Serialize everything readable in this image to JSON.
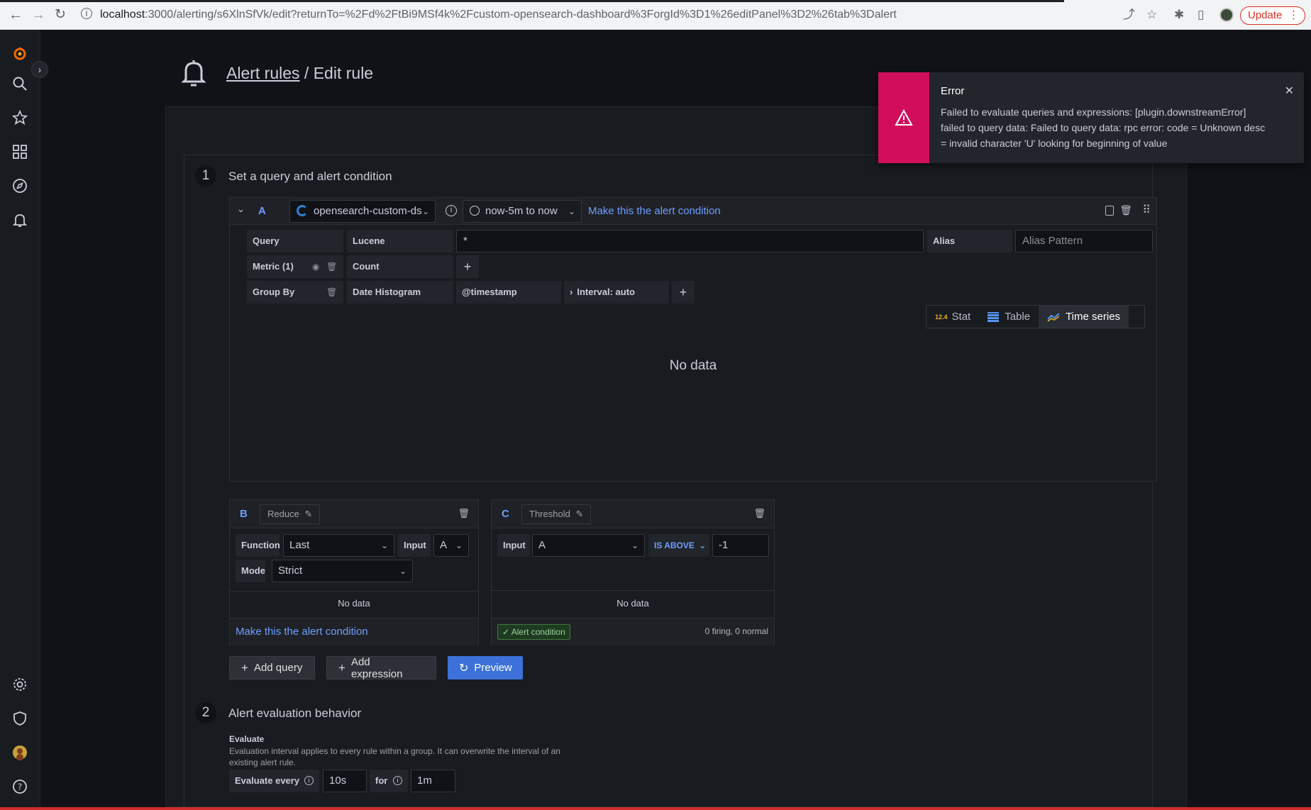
{
  "browser": {
    "url_host": "localhost",
    "url_rest": ":3000/alerting/s6XlnSfVk/edit?returnTo=%2Fd%2FtBi9MSf4k%2Fcustom-opensearch-dashboard%3ForgId%3D1%26editPanel%3D2%26tab%3Dalert",
    "update_label": "Update"
  },
  "header": {
    "link": "Alert rules",
    "separator": " / ",
    "title": "Edit rule"
  },
  "step1": {
    "number": "1",
    "title": "Set a query and alert condition"
  },
  "queryA": {
    "letter": "A",
    "datasource": "opensearch-custom-ds",
    "timerange": "now-5m to now",
    "make_condition": "Make this the alert condition",
    "query_label": "Query",
    "query_type": "Lucene",
    "query_value": "*",
    "alias_label": "Alias",
    "alias_placeholder": "Alias Pattern",
    "metric_label": "Metric (1)",
    "metric_value": "Count",
    "groupby_label": "Group By",
    "groupby_value": "Date Histogram",
    "groupby_field": "@timestamp",
    "interval": "Interval: auto",
    "viz": {
      "stat": "Stat",
      "table": "Table",
      "timeseries": "Time series",
      "stat_badge": "12.4"
    },
    "no_data": "No data"
  },
  "exprB": {
    "letter": "B",
    "type": "Reduce",
    "function_label": "Function",
    "function_value": "Last",
    "input_label": "Input",
    "input_value": "A",
    "mode_label": "Mode",
    "mode_value": "Strict",
    "no_data": "No data",
    "make_condition": "Make this the alert condition"
  },
  "exprC": {
    "letter": "C",
    "type": "Threshold",
    "input_label": "Input",
    "input_value": "A",
    "op": "IS ABOVE",
    "value": "-1",
    "no_data": "No data",
    "condition_badge": "Alert condition",
    "status": "0 firing, 0 normal"
  },
  "actions": {
    "add_query": "Add query",
    "add_expression": "Add expression",
    "preview": "Preview"
  },
  "step2": {
    "number": "2",
    "title": "Alert evaluation behavior",
    "evaluate_heading": "Evaluate",
    "evaluate_desc": "Evaluation interval applies to every rule within a group. It can overwrite the interval of an existing alert rule.",
    "evaluate_every_label": "Evaluate every",
    "evaluate_every_value": "10s",
    "for_label": "for",
    "for_value": "1m"
  },
  "toast": {
    "title": "Error",
    "message": "Failed to evaluate queries and expressions: [plugin.downstreamError] failed to query data: Failed to query data: rpc error: code = Unknown desc = invalid character 'U' looking for beginning of value"
  },
  "colors": {
    "accent": "#6e9fff",
    "error": "#d10e5c",
    "primary_button": "#3d71d9",
    "background": "#111217"
  }
}
